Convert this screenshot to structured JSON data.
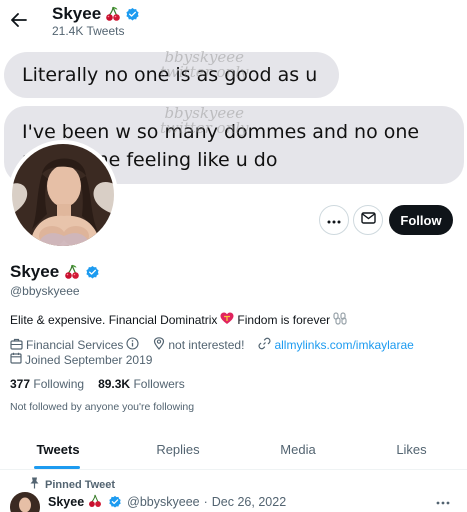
{
  "header": {
    "name": "Skyee",
    "tweet_count": "21.4K Tweets"
  },
  "banner": {
    "message1": "Literally no one is as good as u",
    "message2_line1": "I've been w so many dommes and no one",
    "message2_line2": "makes me feeling like u do",
    "watermark_line1": "bbyskyeee",
    "watermark_line2": "twitter only"
  },
  "actions": {
    "follow_label": "Follow"
  },
  "profile": {
    "name": "Skyee",
    "handle": "@bbyskyeee",
    "bio": "Elite & expensive. Financial Dominatrix",
    "bio_tail": "Findom is forever",
    "category": "Financial Services",
    "location": "not interested!",
    "website": "allmylinks.com/imkaylarae",
    "joined": "Joined September 2019",
    "following_count": "377",
    "following_label": "Following",
    "followers_count": "89.3K",
    "followers_label": "Followers",
    "not_followed_note": "Not followed by anyone you're following"
  },
  "tabs": [
    {
      "label": "Tweets",
      "active": true
    },
    {
      "label": "Replies",
      "active": false
    },
    {
      "label": "Media",
      "active": false
    },
    {
      "label": "Likes",
      "active": false
    }
  ],
  "pinned_tweet": {
    "pinned_label": "Pinned Tweet",
    "name": "Skyee",
    "handle": "@bbyskyeee",
    "separator": "·",
    "date": "Dec 26, 2022"
  },
  "colors": {
    "accent": "#1d9bf0",
    "text_primary": "#0f1419",
    "text_secondary": "#536471",
    "follow_button": "#0f1419",
    "bubble": "#e5e5ea"
  },
  "icons": [
    "back-arrow-icon",
    "verified-badge-icon",
    "cherry-emoji-icon",
    "more-icon",
    "message-icon",
    "heart-emoji-icon",
    "chains-emoji-icon",
    "briefcase-icon",
    "info-icon",
    "location-pin-icon",
    "link-icon",
    "calendar-icon",
    "pin-icon"
  ]
}
